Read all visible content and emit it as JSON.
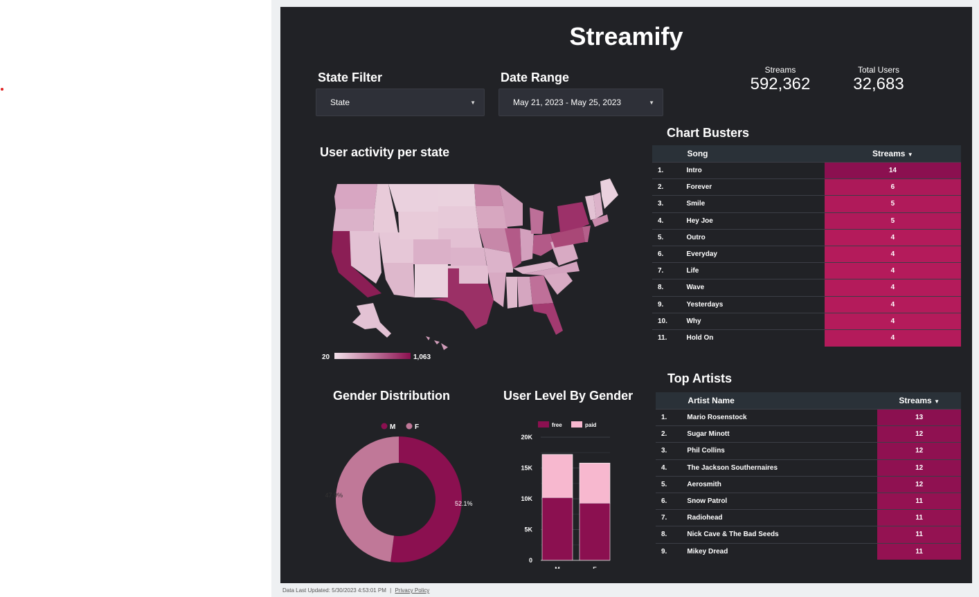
{
  "dashboard": {
    "title": "Streamify",
    "state_filter": {
      "label": "State Filter",
      "value": "State"
    },
    "date_range": {
      "label": "Date Range",
      "value": "May 21, 2023 - May 25, 2023"
    },
    "kpis": [
      {
        "label": "Streams",
        "value": "592,362"
      },
      {
        "label": "Total Users",
        "value": "32,683"
      }
    ],
    "map": {
      "title": "User activity per state",
      "legend_min": "20",
      "legend_max": "1,063"
    },
    "footer": {
      "updated": "Data Last Updated: 5/30/2023 4:53:01 PM",
      "privacy": "Privacy Policy",
      "separator": "|"
    }
  },
  "chart_busters": {
    "title": "Chart Busters",
    "col_song": "Song",
    "col_streams": "Streams",
    "rows": [
      {
        "rank": "1.",
        "name": "Intro",
        "streams": 14
      },
      {
        "rank": "2.",
        "name": "Forever",
        "streams": 6
      },
      {
        "rank": "3.",
        "name": "Smile",
        "streams": 5
      },
      {
        "rank": "4.",
        "name": "Hey Joe",
        "streams": 5
      },
      {
        "rank": "5.",
        "name": "Outro",
        "streams": 4
      },
      {
        "rank": "6.",
        "name": "Everyday",
        "streams": 4
      },
      {
        "rank": "7.",
        "name": "Life",
        "streams": 4
      },
      {
        "rank": "8.",
        "name": "Wave",
        "streams": 4
      },
      {
        "rank": "9.",
        "name": "Yesterdays",
        "streams": 4
      },
      {
        "rank": "10.",
        "name": "Why",
        "streams": 4
      },
      {
        "rank": "11.",
        "name": "Hold On",
        "streams": 4
      }
    ]
  },
  "top_artists": {
    "title": "Top Artists",
    "col_artist": "Artist Name",
    "col_streams": "Streams",
    "rows": [
      {
        "rank": "1.",
        "name": "Mario Rosenstock",
        "streams": 13
      },
      {
        "rank": "2.",
        "name": "Sugar Minott",
        "streams": 12
      },
      {
        "rank": "3.",
        "name": "Phil Collins",
        "streams": 12
      },
      {
        "rank": "4.",
        "name": "The Jackson Southernaires",
        "streams": 12
      },
      {
        "rank": "5.",
        "name": "Aerosmith",
        "streams": 12
      },
      {
        "rank": "6.",
        "name": "Snow Patrol",
        "streams": 11
      },
      {
        "rank": "7.",
        "name": "Radiohead",
        "streams": 11
      },
      {
        "rank": "8.",
        "name": "Nick Cave & The Bad Seeds",
        "streams": 11
      },
      {
        "rank": "9.",
        "name": "Mikey Dread",
        "streams": 11
      }
    ]
  },
  "chart_data": [
    {
      "type": "pie",
      "title": "Gender Distribution",
      "labels": [
        "M",
        "F"
      ],
      "values": [
        52.1,
        47.9
      ],
      "value_labels": [
        "52.1%",
        "47.9%"
      ],
      "colors": [
        "#8b1050",
        "#c07898"
      ],
      "donut": true,
      "legend": "top"
    },
    {
      "type": "bar",
      "stacked": true,
      "title": "User Level By Gender",
      "categories": [
        "M",
        "F"
      ],
      "series": [
        {
          "name": "free",
          "values": [
            10200,
            9300
          ],
          "color": "#8b1050"
        },
        {
          "name": "paid",
          "values": [
            7000,
            6500
          ],
          "color": "#f7b8cf"
        }
      ],
      "ylim": [
        0,
        20000
      ],
      "yticks": [
        "0",
        "5K",
        "10K",
        "15K",
        "20K"
      ],
      "grid": true,
      "legend": "top"
    }
  ]
}
